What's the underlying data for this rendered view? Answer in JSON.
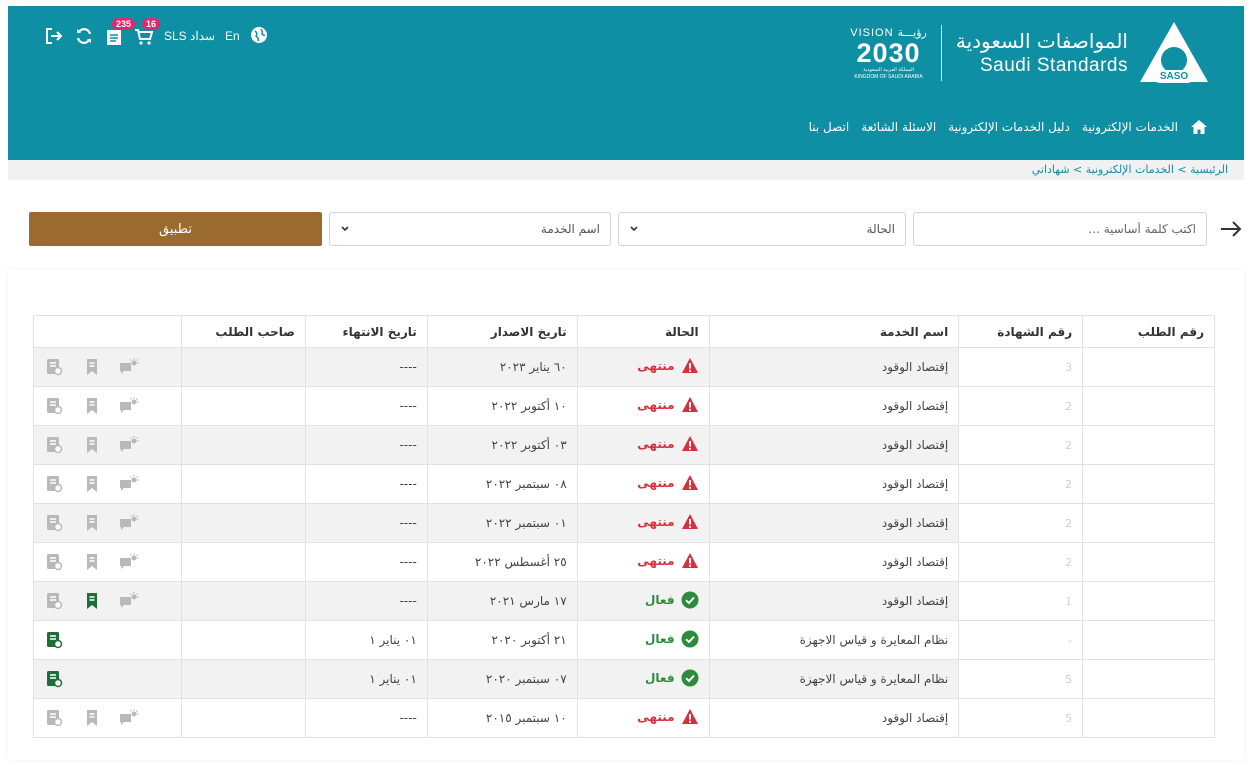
{
  "header": {
    "logo_ar": "المواصفات السعودية",
    "logo_en": "Saudi Standards",
    "logo_badge": "SASO",
    "vision_top": "VISION رؤيـــة",
    "vision_num": "2030",
    "vision_sub_ar": "المملكة العربية السعودية",
    "vision_sub_en": "KINGDOM OF SAUDI ARABIA",
    "brand_color": "#0f8fa4",
    "nav": {
      "home_icon": "home-icon",
      "items": [
        "الخدمات الإلكترونية",
        "دليل الخدمات الإلكترونية",
        "الاسئلة الشائعة",
        "اتصل بنا"
      ]
    },
    "tools": {
      "logout_icon": "logout-icon",
      "refresh_icon": "refresh-icon",
      "requests_badge": "235",
      "cart_badge": "16",
      "sadad_label": "SLS سداد",
      "lang_label": "En",
      "globe_icon": "globe-icon",
      "badge_color": "#e3266f"
    }
  },
  "breadcrumb": {
    "items": [
      "الرئيسية",
      "الخدمات الإلكترونية",
      "شهاداتي"
    ],
    "separator": " > "
  },
  "filters": {
    "keyword_placeholder": "اكتب كلمة أساسية ...",
    "status_placeholder": "الحالة",
    "service_placeholder": "اسم الخدمة",
    "apply_label": "تطبيق",
    "apply_color": "#9a6a2e"
  },
  "table": {
    "headers": {
      "request_no": "رقم الطلب",
      "cert_no": "رقم الشهادة",
      "service": "اسم الخدمة",
      "status": "الحالة",
      "issue_date": "تاريخ الاصدار",
      "end_date": "تاريخ الانتهاء",
      "owner": "صاحب الطلب"
    },
    "rows": [
      {
        "req": "",
        "cert": "3",
        "service": "إقتصاد الوقود",
        "status": "منتهى",
        "issue": "٦٠ يناير ٢٠٢٣",
        "end": "----",
        "owner": ""
      },
      {
        "req": "",
        "cert": "2",
        "service": "إقتصاد الوقود",
        "status": "منتهى",
        "issue": "١٠ أكتوبر ٢٠٢٢",
        "end": "----",
        "owner": ""
      },
      {
        "req": "",
        "cert": "2",
        "service": "إقتصاد الوقود",
        "status": "منتهى",
        "issue": "٠٣ أكتوبر ٢٠٢٢",
        "end": "----",
        "owner": ""
      },
      {
        "req": "",
        "cert": "2",
        "service": "إقتصاد الوقود",
        "status": "منتهى",
        "issue": "٠٨ سبتمبر ٢٠٢٢",
        "end": "----",
        "owner": ""
      },
      {
        "req": "",
        "cert": "2",
        "service": "إقتصاد الوقود",
        "status": "منتهى",
        "issue": "٠١ سبتمبر ٢٠٢٢",
        "end": "----",
        "owner": ""
      },
      {
        "req": "",
        "cert": "2",
        "service": "إقتصاد الوقود",
        "status": "منتهى",
        "issue": "٢٥ أغسطس ٢٠٢٢",
        "end": "----",
        "owner": ""
      },
      {
        "req": "",
        "cert": "1",
        "service": "إقتصاد الوقود",
        "status": "فعال",
        "issue": "١٧ مارس ٢٠٢١",
        "end": "----",
        "owner": ""
      },
      {
        "req": "",
        "cert": "-",
        "service": "نظام المعايرة و قياس الاجهزة",
        "status": "فعال",
        "issue": "٢١ أكتوبر ٢٠٢٠",
        "end": "٠١ يناير ١",
        "owner": ""
      },
      {
        "req": "",
        "cert": "5",
        "service": "نظام المعايرة و قياس الاجهزة",
        "status": "فعال",
        "issue": "٠٧ سبتمبر ٢٠٢٠",
        "end": "٠١ يناير ١",
        "owner": ""
      },
      {
        "req": "",
        "cert": "5",
        "service": "إقتصاد الوقود",
        "status": "منتهى",
        "issue": "١٠ سبتمبر ٢٠١٥",
        "end": "----",
        "owner": ""
      }
    ],
    "colors": {
      "expired": "#d6303f",
      "active": "#2e8b3d",
      "active_icon": "#1f6e3a",
      "muted_icon": "#b9b9b9"
    }
  }
}
